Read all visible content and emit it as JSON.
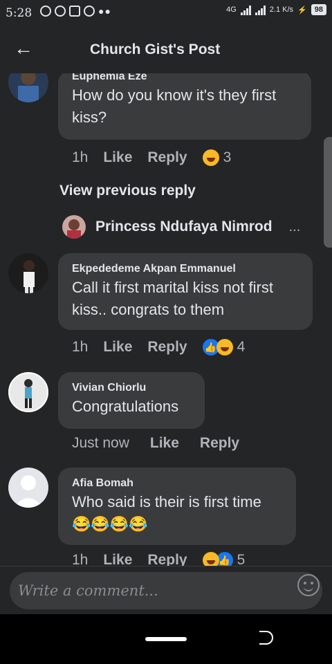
{
  "status": {
    "time": "5:28",
    "network": "4G",
    "speed": "2.1 K/s",
    "battery": "98"
  },
  "header": {
    "title": "Church Gist's Post"
  },
  "comments": [
    {
      "name": "Euphemia Eze",
      "text_lines": [
        "How do you know it's they first",
        "kiss?"
      ],
      "time": "1h",
      "like": "Like",
      "reply": "Reply",
      "reaction_count": "3",
      "reactions": [
        "haha-icon"
      ]
    },
    {
      "name": "Ekpededeme Akpan Emmanuel",
      "text_lines": [
        "Call it first marital kiss not first",
        "kiss.. congrats to them"
      ],
      "time": "1h",
      "like": "Like",
      "reply": "Reply",
      "reaction_count": "4",
      "reactions": [
        "like-icon",
        "haha-icon"
      ]
    },
    {
      "name": "Vivian Chiorlu",
      "text_lines": [
        "Congratulations"
      ],
      "time": "Just now",
      "like": "Like",
      "reply": "Reply",
      "reaction_count": "",
      "reactions": []
    },
    {
      "name": "Afia Bomah",
      "text_lines": [
        "Who said is their is first time",
        "😂😂😂😂"
      ],
      "time": "1h",
      "like": "Like",
      "reply": "Reply",
      "reaction_count": "5",
      "reactions": [
        "haha-icon",
        "like-icon"
      ]
    }
  ],
  "view_previous": "View previous reply",
  "princess": {
    "name": "Princess Ndufaya Nimrod",
    "more": "..."
  },
  "composer": {
    "placeholder": "Write a comment..."
  },
  "colors": {
    "background": "#242526",
    "bubble": "#3a3b3c",
    "text": "#e4e6eb",
    "muted": "#b0b3b8",
    "like_blue": "#1877f2",
    "haha_yellow": "#f7b928"
  }
}
